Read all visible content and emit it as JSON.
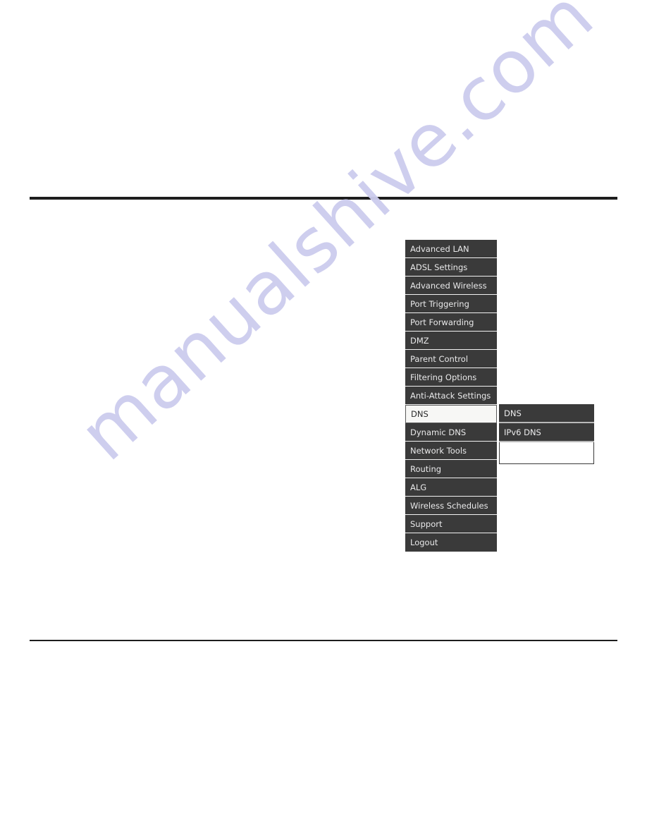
{
  "page": {
    "background_color": "#ffffff",
    "rule_color": "#1d1d1d"
  },
  "watermark": {
    "text": "manualshive.com",
    "color": "#ccccee"
  },
  "main_menu": {
    "background_color": "#3a3a3a",
    "text_color": "#e9e9ea",
    "selected_background_color": "#f7f7f5",
    "selected_text_color": "#2a2a2a",
    "items": [
      {
        "label": "Advanced LAN",
        "selected": false
      },
      {
        "label": "ADSL Settings",
        "selected": false
      },
      {
        "label": "Advanced Wireless",
        "selected": false
      },
      {
        "label": "Port Triggering",
        "selected": false
      },
      {
        "label": "Port Forwarding",
        "selected": false
      },
      {
        "label": "DMZ",
        "selected": false
      },
      {
        "label": "Parent Control",
        "selected": false
      },
      {
        "label": "Filtering Options",
        "selected": false
      },
      {
        "label": "Anti-Attack Settings",
        "selected": false
      },
      {
        "label": "DNS",
        "selected": true
      },
      {
        "label": "Dynamic DNS",
        "selected": false
      },
      {
        "label": "Network Tools",
        "selected": false
      },
      {
        "label": "Routing",
        "selected": false
      },
      {
        "label": "ALG",
        "selected": false
      },
      {
        "label": "Wireless Schedules",
        "selected": false
      },
      {
        "label": "Support",
        "selected": false
      },
      {
        "label": "Logout",
        "selected": false
      }
    ]
  },
  "submenu": {
    "parent": "DNS",
    "background_color": "#3a3a3a",
    "text_color": "#ededee",
    "separator_color": "#b9b9b9",
    "items": [
      {
        "label": "DNS"
      },
      {
        "label": "IPv6 DNS"
      }
    ],
    "trailing_blank_panel": true
  }
}
